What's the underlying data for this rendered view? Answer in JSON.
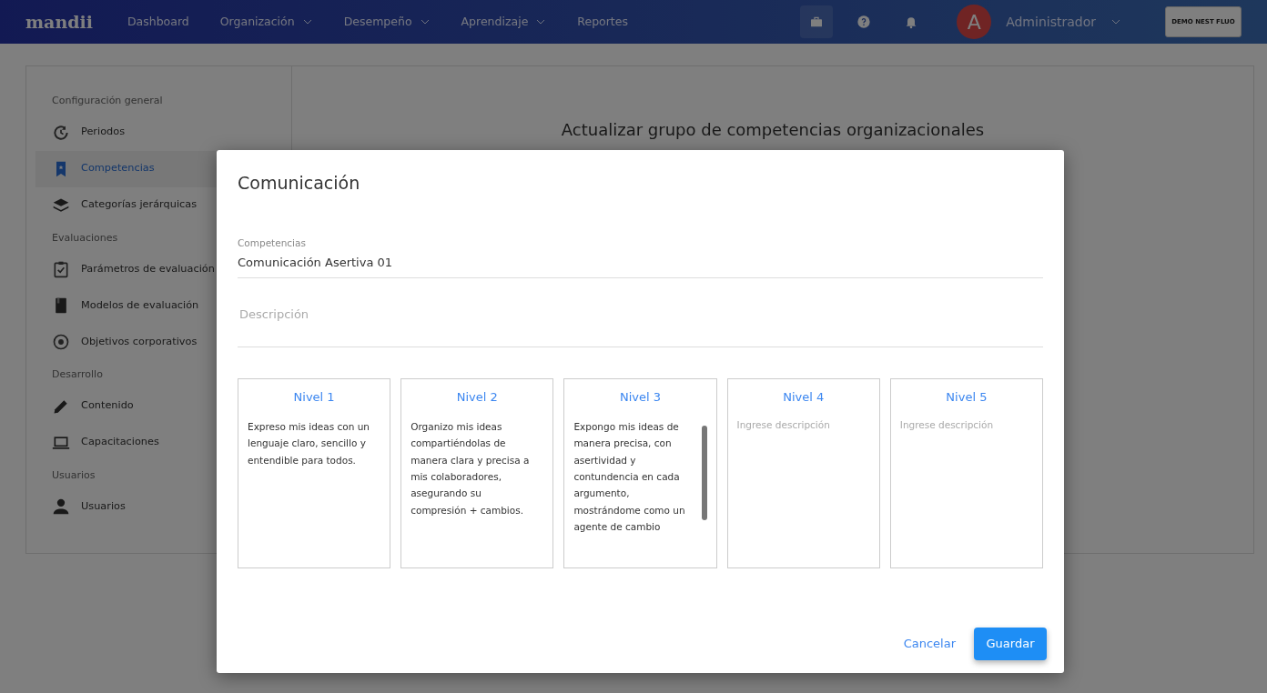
{
  "navbar": {
    "logo": "mandii",
    "items": [
      {
        "label": "Dashboard",
        "dropdown": false
      },
      {
        "label": "Organización",
        "dropdown": true
      },
      {
        "label": "Desempeño",
        "dropdown": true
      },
      {
        "label": "Aprendizaje",
        "dropdown": true
      },
      {
        "label": "Reportes",
        "dropdown": false
      }
    ],
    "user": {
      "initial": "A",
      "name": "Administrador"
    },
    "company": "DEMO NEST FLUO"
  },
  "sidebar": [
    {
      "title": "Configuración general",
      "items": [
        {
          "label": "Periodos",
          "selected": false
        },
        {
          "label": "Competencias",
          "selected": true
        },
        {
          "label": "Categorías jerárquicas",
          "selected": false
        }
      ]
    },
    {
      "title": "Evaluaciones",
      "items": [
        {
          "label": "Parámetros de evaluación",
          "selected": false
        },
        {
          "label": "Modelos de evaluación",
          "selected": false
        },
        {
          "label": "Objetivos corporativos",
          "selected": false
        }
      ]
    },
    {
      "title": "Desarrollo",
      "items": [
        {
          "label": "Contenido",
          "selected": false
        },
        {
          "label": "Capacitaciones",
          "selected": false
        }
      ]
    },
    {
      "title": "Usuarios",
      "items": [
        {
          "label": "Usuarios",
          "selected": false
        }
      ]
    }
  ],
  "main_title": "Actualizar grupo de competencias organizacionales",
  "modal": {
    "title": "Comunicación",
    "competencia": {
      "label": "Competencias",
      "value": "Comunicación Asertiva 01"
    },
    "descripcion": {
      "placeholder": "Descripción"
    },
    "levels": [
      {
        "title": "Nivel 1",
        "text": "Expreso mis ideas con un lenguaje claro, sencillo y entendible para todos."
      },
      {
        "title": "Nivel 2",
        "text": "Organizo mis ideas compartiéndolas de manera clara y precisa a mis colaboradores, asegurando su compresión + cambios."
      },
      {
        "title": "Nivel 3",
        "text": "Expongo mis ideas de manera precisa, con asertividad y contundencia en cada argumento, mostrándome como un agente de cambio"
      },
      {
        "title": "Nivel 4",
        "placeholder": "Ingrese descripción"
      },
      {
        "title": "Nivel 5",
        "placeholder": "Ingrese descripción"
      }
    ],
    "cancel": "Cancelar",
    "save": "Guardar"
  }
}
